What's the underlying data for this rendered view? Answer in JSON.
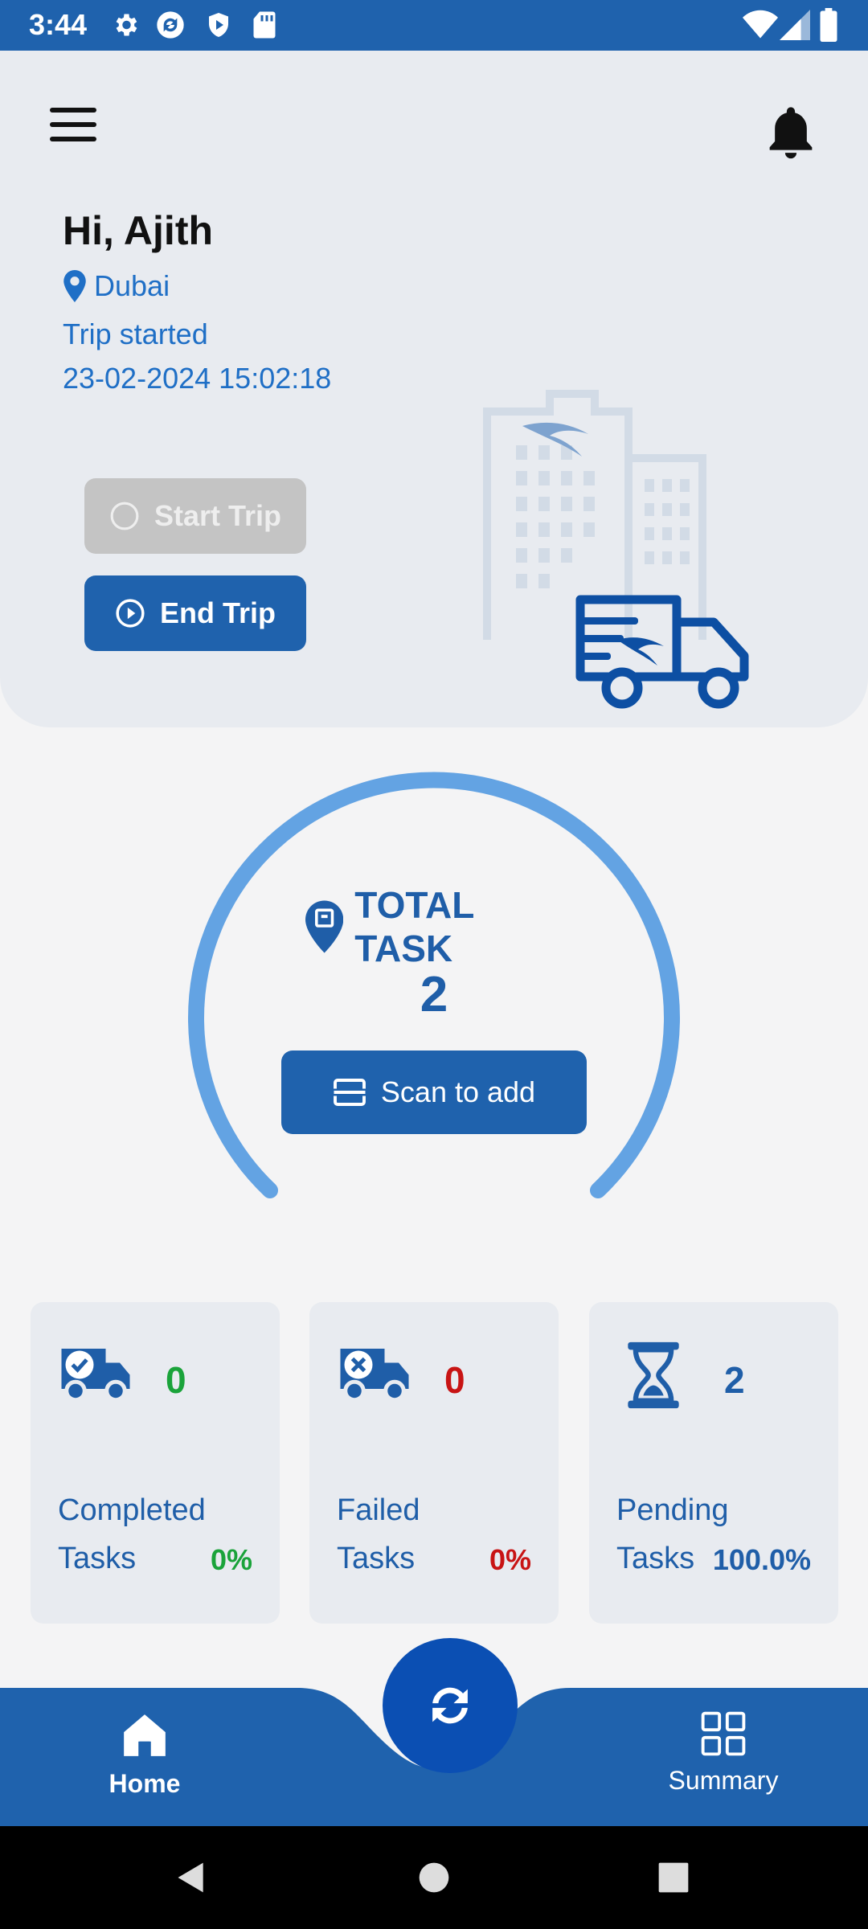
{
  "status_bar": {
    "time": "3:44"
  },
  "header": {
    "greeting": "Hi, Ajith",
    "location": "Dubai",
    "trip_status": "Trip started",
    "trip_datetime": "23-02-2024 15:02:18",
    "start_trip_label": "Start Trip",
    "end_trip_label": "End Trip"
  },
  "total_task": {
    "title": "TOTAL TASK",
    "count": "2",
    "scan_label": "Scan to add"
  },
  "cards": [
    {
      "count": "0",
      "line1": "Completed",
      "line2": "Tasks",
      "percent": "0%",
      "color": "#1aa33a",
      "icon": "truck-check-icon"
    },
    {
      "count": "0",
      "line1": "Failed",
      "line2": "Tasks",
      "percent": "0%",
      "color": "#c81414",
      "icon": "truck-x-icon"
    },
    {
      "count": "2",
      "line1": "Pending",
      "line2": "Tasks",
      "percent": "100.0%",
      "color": "#1f5ea8",
      "icon": "hourglass-icon"
    }
  ],
  "bottom_nav": {
    "home_label": "Home",
    "summary_label": "Summary"
  },
  "colors": {
    "primary": "#1f62ad",
    "gauge": "#63a3e3",
    "panel": "#e8ebf0"
  }
}
